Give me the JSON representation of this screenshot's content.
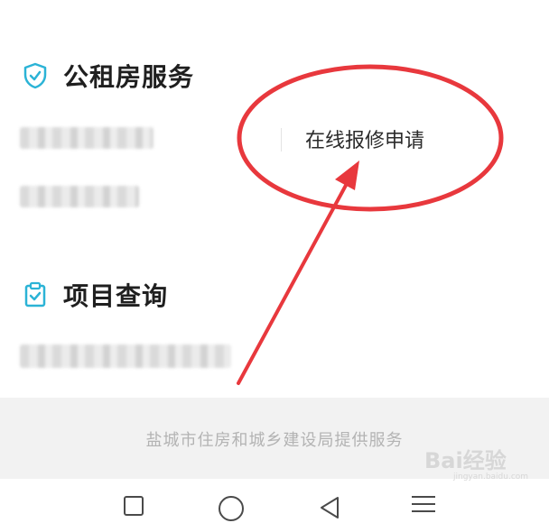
{
  "sections": {
    "public_housing": {
      "title": "公租房服务",
      "icon": "shield-check-icon"
    },
    "project_query": {
      "title": "项目查询",
      "icon": "clipboard-check-icon"
    }
  },
  "links": {
    "online_repair": "在线报修申请"
  },
  "footer": {
    "text": "盐城市住房和城乡建设局提供服务"
  },
  "navbar": {
    "icons": [
      "recent-apps-icon",
      "home-icon",
      "back-icon",
      "menu-icon"
    ]
  },
  "watermark": {
    "brand": "Bai经验",
    "url": "jingyan.baidu.com"
  },
  "colors": {
    "accent": "#2bb3d6",
    "annotation_red": "#e8383d",
    "footer_bg": "#f2f2f2"
  }
}
